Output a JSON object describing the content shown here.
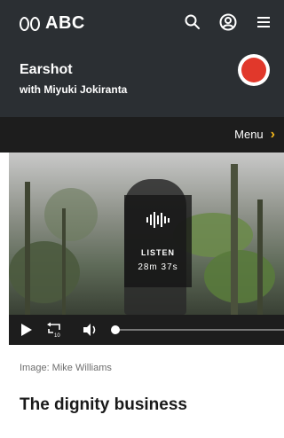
{
  "header": {
    "logo_text": "ABC",
    "icons": [
      "search-icon",
      "account-icon",
      "hamburger-menu-icon"
    ],
    "background": "#2b2f33"
  },
  "program": {
    "title": "Earshot",
    "host": "with Miyuki Jokiranta",
    "badge_icon": "earshot-logo-badge",
    "badge_color": "#e1382b"
  },
  "menu": {
    "label": "Menu",
    "chevron_color": "#f2b51b"
  },
  "hero": {
    "listen_label": "LISTEN",
    "duration": "28m 37s",
    "wave_icon": "audio-wave-icon"
  },
  "player": {
    "controls": [
      "play-icon",
      "rewind-10-icon",
      "volume-icon"
    ],
    "rewind_text": "10",
    "progress": 0
  },
  "article": {
    "image_credit": "Image: Mike Williams",
    "title": "The dignity business"
  }
}
